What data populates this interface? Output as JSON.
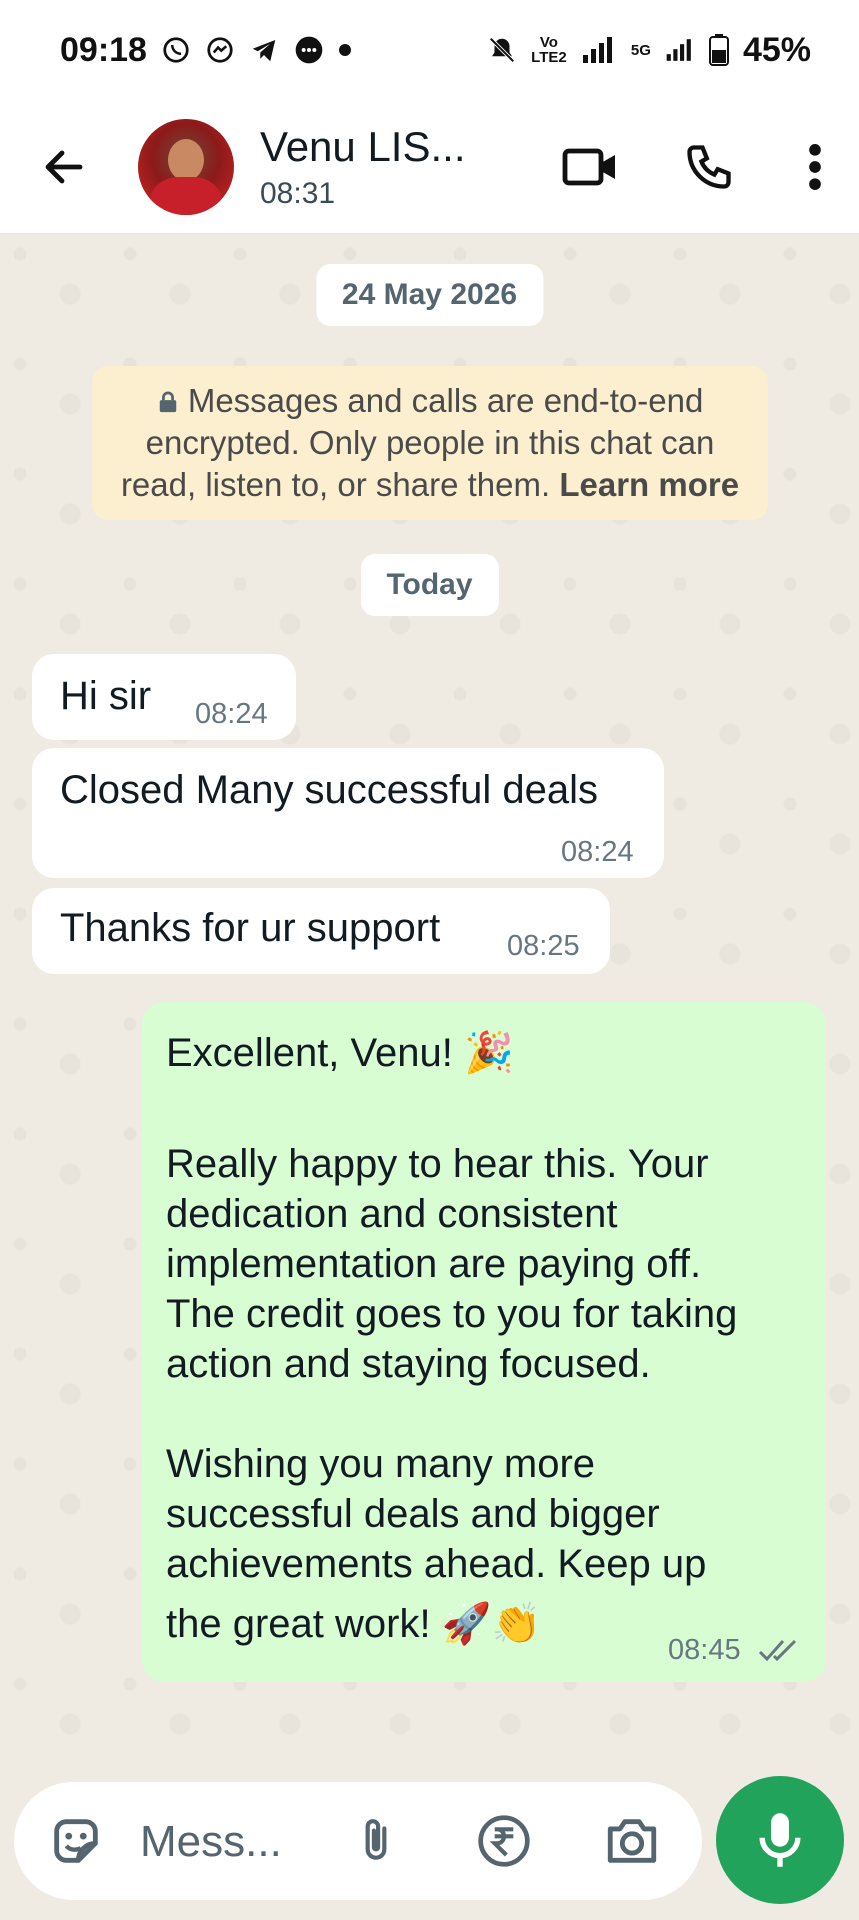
{
  "status_bar": {
    "time": "09:18",
    "battery": "45%",
    "network": "5G",
    "volte": "Vo LTE2"
  },
  "header": {
    "contact_name": "Venu LIS...",
    "last_seen": "08:31",
    "icons": [
      "back-arrow-icon",
      "video-call-icon",
      "phone-icon",
      "more-vert-icon"
    ]
  },
  "chat": {
    "date_pill": "24 May 2026",
    "encryption": {
      "text": "Messages and calls are end-to-end encrypted. Only people in this chat can read, listen to, or share them.",
      "learn_more": "Learn more"
    },
    "today_pill": "Today",
    "incoming": [
      {
        "text": "Hi sir",
        "time": "08:24"
      },
      {
        "text": "Closed Many successful deals",
        "time": "08:24"
      },
      {
        "text": "Thanks for ur support",
        "time": "08:25"
      }
    ],
    "outgoing": {
      "line1": "Excellent, Venu! 🎉",
      "para2_l1": "Really happy to hear this. Your",
      "para2_l2": "dedication and consistent",
      "para2_l3": "implementation are paying off.",
      "para2_l4": "The credit goes to you for taking",
      "para2_l5": "action and staying focused.",
      "para3_l1": "Wishing you many more",
      "para3_l2": "successful deals and bigger",
      "para3_l3": "achievements ahead. Keep up",
      "para3_l4": "the great work! 🚀👏",
      "time": "08:45"
    }
  },
  "input": {
    "placeholder": "Mess..."
  },
  "colors": {
    "outgoing_bubble": "#d9fdd3",
    "chat_background": "#efeae2",
    "mic_button": "#21a35b",
    "read_ticks": "#667781"
  }
}
